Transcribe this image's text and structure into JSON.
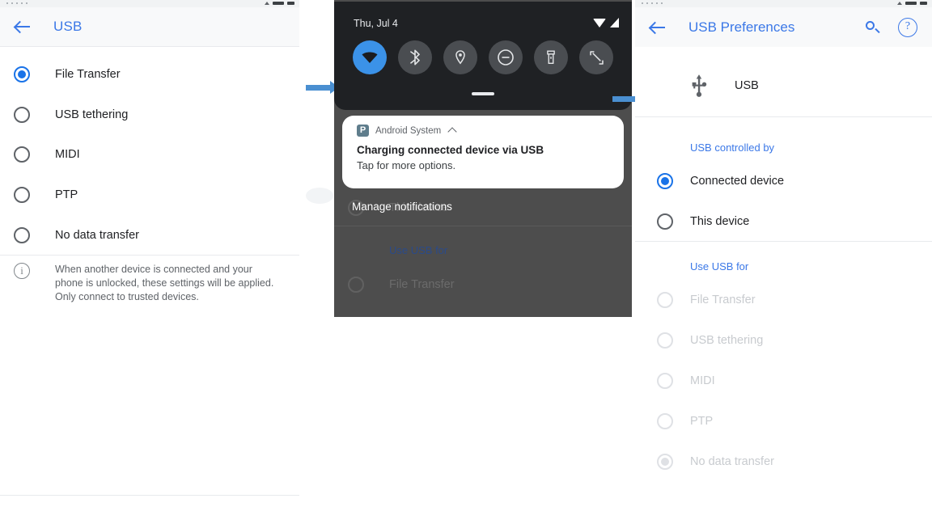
{
  "panel1": {
    "statusbar": {
      "icons": [
        "signal-triangle-icon",
        "battery-icon",
        "wifi-icon"
      ]
    },
    "appbar": {
      "back_icon": "back-arrow-icon",
      "title": "USB"
    },
    "options": [
      {
        "label": "File Transfer",
        "selected": true
      },
      {
        "label": "USB tethering",
        "selected": false
      },
      {
        "label": "MIDI",
        "selected": false
      },
      {
        "label": "PTP",
        "selected": false
      },
      {
        "label": "No data transfer",
        "selected": false
      }
    ],
    "info": {
      "icon": "info-icon",
      "text": "When another device is connected and your phone is unlocked, these settings will be applied. Only connect to trusted devices."
    }
  },
  "panel2": {
    "statusbar": {
      "date": "Thu, Jul 4",
      "icons": [
        "wifi-icon",
        "cellular-signal-icon"
      ]
    },
    "quick_tiles": [
      {
        "name": "wifi-tile",
        "icon": "wifi-icon",
        "active": true
      },
      {
        "name": "bluetooth-tile",
        "icon": "bluetooth-icon",
        "active": false
      },
      {
        "name": "location-tile",
        "icon": "location-pin-icon",
        "active": false
      },
      {
        "name": "dnd-tile",
        "icon": "do-not-disturb-icon",
        "active": false
      },
      {
        "name": "flashlight-tile",
        "icon": "flashlight-icon",
        "active": false
      },
      {
        "name": "autorotate-tile",
        "icon": "auto-rotate-icon",
        "active": false
      }
    ],
    "notification": {
      "app_icon": "android-system-icon",
      "app_name": "Android System",
      "collapse_icon": "chevron-up-icon",
      "title": "Charging connected device via USB",
      "subtitle": "Tap for more options."
    },
    "manage_notifications": "Manage notifications",
    "background": {
      "dimmed_rows": [
        {
          "label": "This device"
        }
      ],
      "heading": "Use USB for",
      "options": [
        {
          "label": "File Transfer"
        }
      ]
    }
  },
  "panel3": {
    "statusbar": {
      "icons": [
        "signal-triangle-icon",
        "battery-icon",
        "wifi-icon"
      ]
    },
    "appbar": {
      "back_icon": "back-arrow-icon",
      "title": "USB Preferences",
      "search_icon": "search-icon",
      "help_icon": "help-icon"
    },
    "usb_row": {
      "icon": "usb-icon",
      "label": "USB"
    },
    "controlled_by": {
      "heading": "USB controlled by",
      "options": [
        {
          "label": "Connected device",
          "selected": true,
          "disabled": false
        },
        {
          "label": "This device",
          "selected": false,
          "disabled": false
        }
      ]
    },
    "use_usb_for": {
      "heading": "Use USB for",
      "options": [
        {
          "label": "File Transfer",
          "selected": false,
          "disabled": true
        },
        {
          "label": "USB tethering",
          "selected": false,
          "disabled": true
        },
        {
          "label": "MIDI",
          "selected": false,
          "disabled": true
        },
        {
          "label": "PTP",
          "selected": false,
          "disabled": true
        },
        {
          "label": "No data transfer",
          "selected": true,
          "disabled": true
        }
      ]
    }
  },
  "flow": {
    "arrow1": "flow-arrow-right",
    "arrow2": "flow-arrow-right"
  },
  "colors": {
    "accent_blue": "#3b78e7",
    "radio_blue": "#1a73e8",
    "tile_active": "#3b92e8",
    "shade_dark": "#1f2124",
    "dim_overlay": "#4d4d4d",
    "arrow_blue": "#4a8fd1",
    "appbar_bg": "#f8f9fa",
    "disabled_text": "#c8cbcf"
  }
}
